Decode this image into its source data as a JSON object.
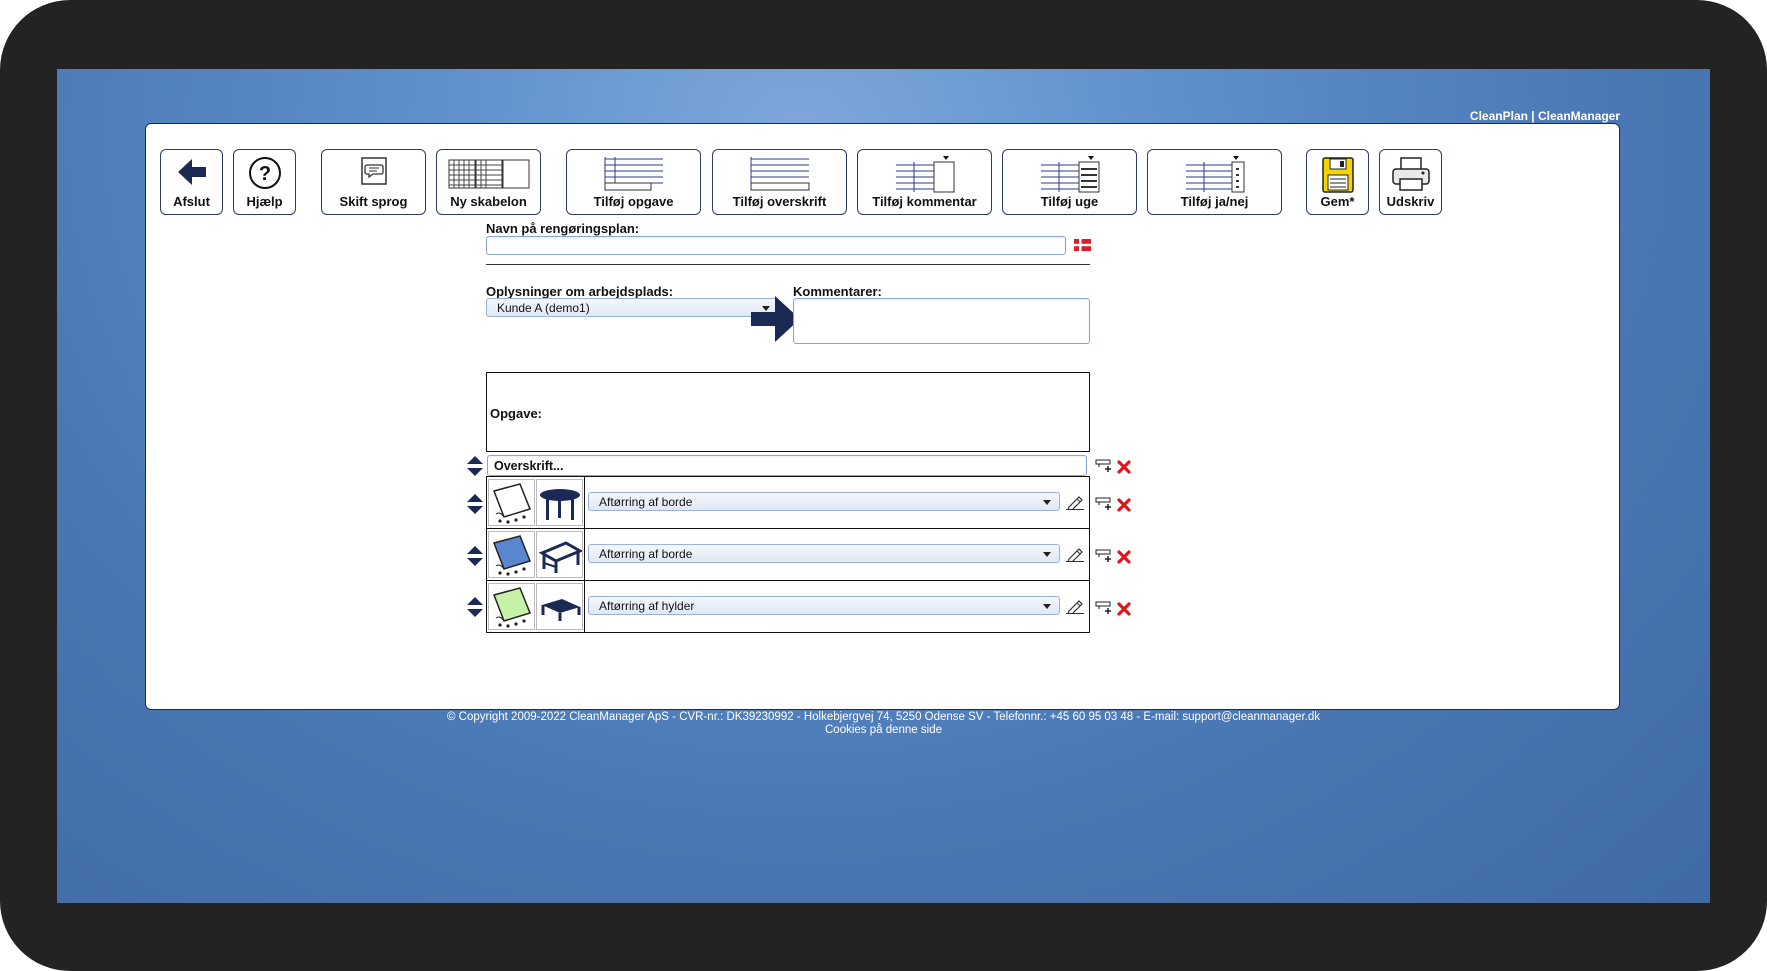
{
  "brand": "CleanPlan | CleanManager",
  "toolbar": {
    "back": "Afslut",
    "help": "Hjælp",
    "language": "Skift sprog",
    "new_template": "Ny skabelon",
    "add_task": "Tilføj opgave",
    "add_heading": "Tilføj overskrift",
    "add_comment": "Tilføj kommentar",
    "add_week": "Tilføj uge",
    "add_yes_no": "Tilføj ja/nej",
    "save": "Gem*",
    "print": "Udskriv"
  },
  "form": {
    "plan_name_label": "Navn på rengøringsplan:",
    "plan_name_value": "",
    "workplace_label": "Oplysninger om arbejdsplads:",
    "workplace_value": "Kunde A (demo1)",
    "comments_label": "Kommentarer:",
    "comments_value": ""
  },
  "tasks": {
    "header": "Opgave:",
    "heading_row_value": "Overskrift...",
    "rows": [
      {
        "task": "Aftørring af borde",
        "cloth_color": "#ffffff",
        "object": "round-table"
      },
      {
        "task": "Aftørring af borde",
        "cloth_color": "#5a86d0",
        "object": "desk"
      },
      {
        "task": "Aftørring af hylder",
        "cloth_color": "#c6f2a8",
        "object": "shelf"
      }
    ]
  },
  "colors": {
    "accent": "#1b2a55",
    "delete": "#e0151b",
    "flag_red": "#d8202b"
  },
  "footer": {
    "copyright": "© Copyright 2009-2022 CleanManager ApS - CVR-nr.: DK39230992 - Holkebjergvej 74, 5250 Odense SV - Telefonnr.: +45 60 95 03 48 - E-mail: support@cleanmanager.dk",
    "cookies": "Cookies på denne side"
  }
}
